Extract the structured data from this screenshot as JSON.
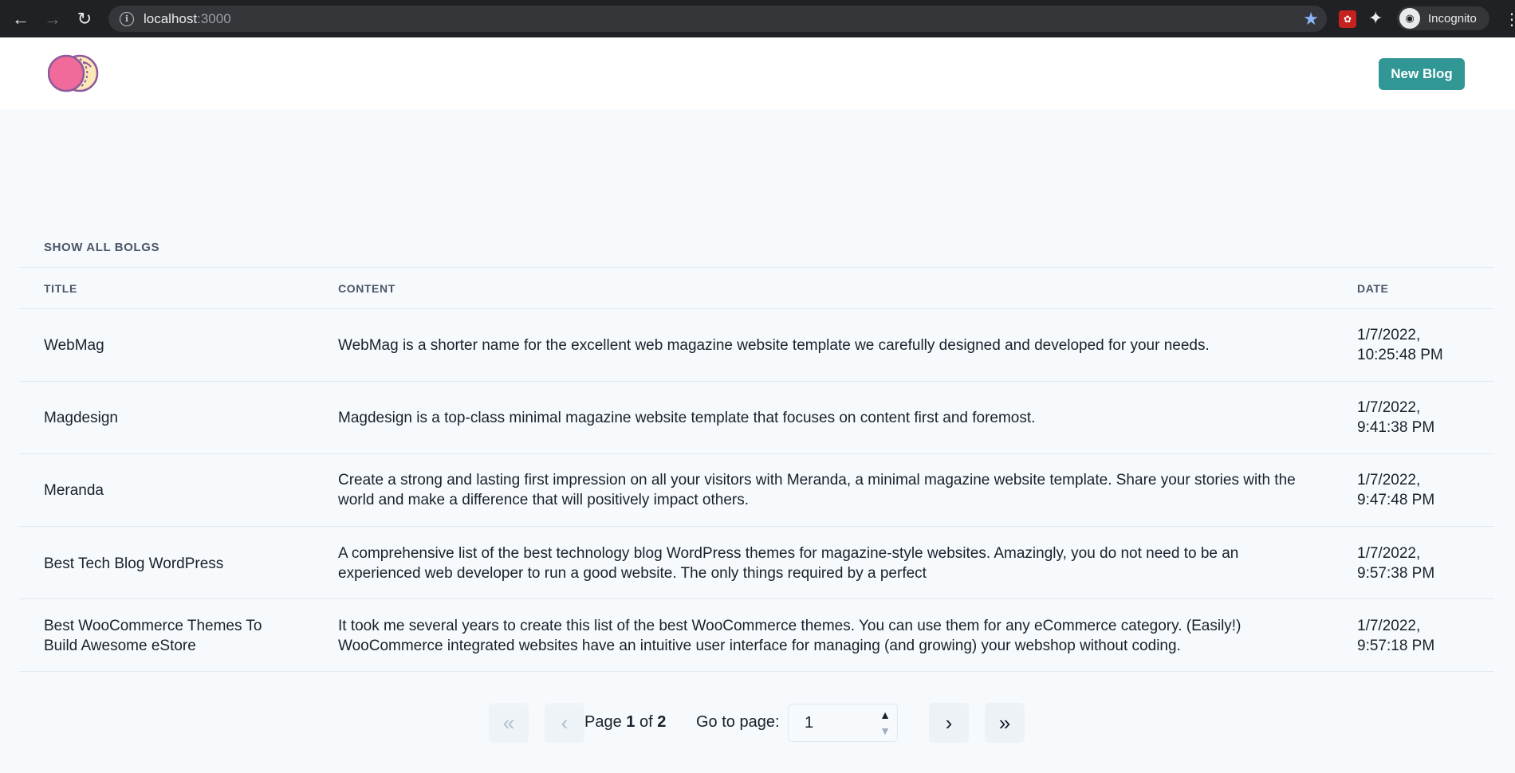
{
  "browser": {
    "url_host": "localhost",
    "url_port": ":3000",
    "profile_label": "Incognito"
  },
  "header": {
    "new_blog_label": "New Blog"
  },
  "table": {
    "caption": "SHOW ALL BOLGS",
    "columns": [
      "TITLE",
      "CONTENT",
      "DATE"
    ],
    "rows": [
      {
        "title": "WebMag",
        "content": "WebMag is a shorter name for the excellent web magazine website template we carefully designed and developed for your needs.",
        "date_line1": "1/7/2022,",
        "date_line2": "10:25:48 PM"
      },
      {
        "title": "Magdesign",
        "content": "Magdesign is a top-class minimal magazine website template that focuses on content first and foremost.",
        "date_line1": "1/7/2022,",
        "date_line2": "9:41:38 PM"
      },
      {
        "title": "Meranda",
        "content": "Create a strong and lasting first impression on all your visitors with Meranda, a minimal magazine website template. Share your stories with the world and make a difference that will positively impact others.",
        "date_line1": "1/7/2022,",
        "date_line2": "9:47:48 PM"
      },
      {
        "title": "Best Tech Blog WordPress",
        "content": "A comprehensive list of the best technology blog WordPress themes for magazine-style websites. Amazingly, you do not need to be an experienced web developer to run a good website. The only things required by a perfect",
        "date_line1": "1/7/2022,",
        "date_line2": "9:57:38 PM"
      },
      {
        "title": "Best WooCommerce Themes To Build Awesome eStore",
        "content": "It took me several years to create this list of the best WooCommerce themes. You can use them for any eCommerce category. (Easily!) WooCommerce integrated websites have an intuitive user interface for managing (and growing) your webshop without coding.",
        "date_line1": "1/7/2022,",
        "date_line2": "9:57:18 PM"
      }
    ]
  },
  "pagination": {
    "page_word": "Page",
    "current_page": "1",
    "of_word": "of",
    "total_pages": "2",
    "goto_label": "Go to page:",
    "goto_value": "1"
  },
  "colors": {
    "accent": "#319795",
    "background": "#f7fafc"
  }
}
